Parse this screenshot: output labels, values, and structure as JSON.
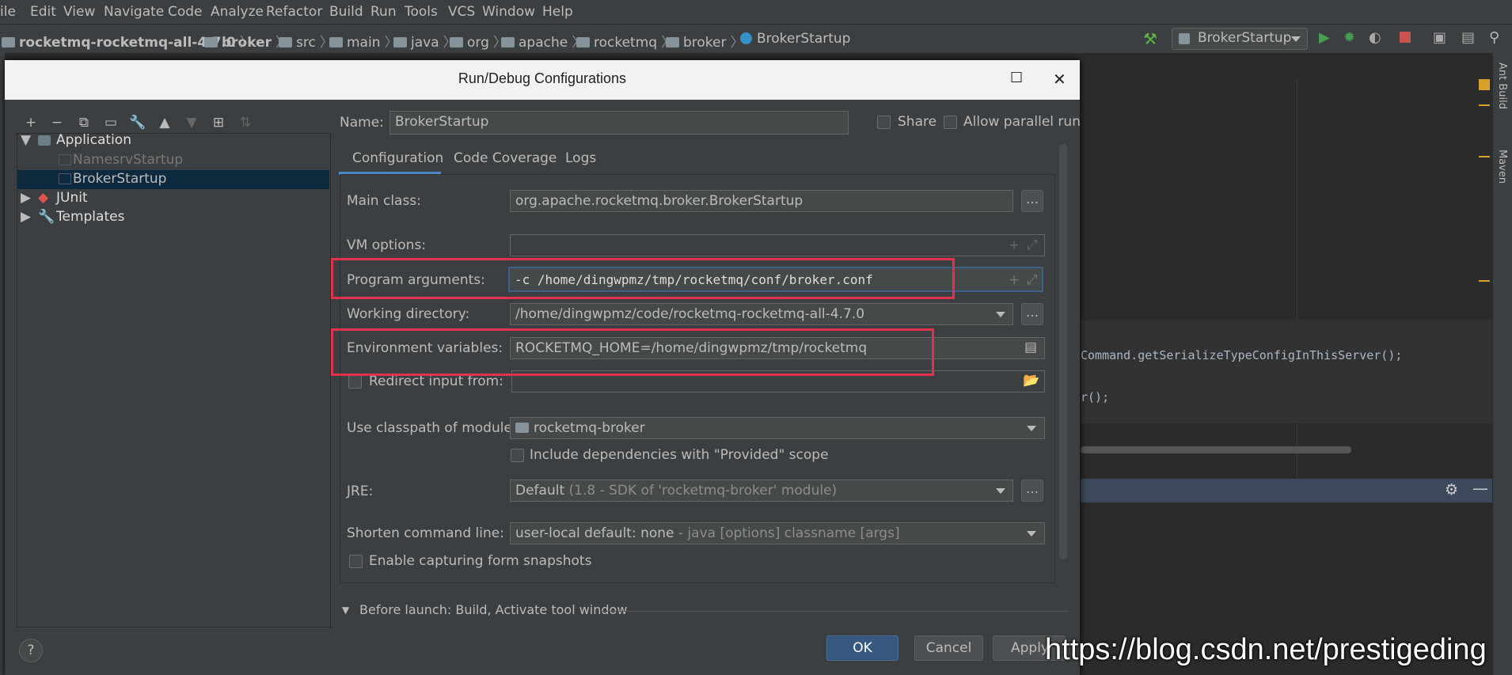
{
  "menu": [
    "ile",
    "Edit",
    "View",
    "Navigate",
    "Code",
    "Analyze",
    "Refactor",
    "Build",
    "Run",
    "Tools",
    "VCS",
    "Window",
    "Help"
  ],
  "breadcrumbs": [
    "rocketmq-rocketmq-all-4.7.0",
    "broker",
    "src",
    "main",
    "java",
    "org",
    "apache",
    "rocketmq",
    "broker",
    "BrokerStartup"
  ],
  "run_config_selector": "BrokerStartup",
  "right_tool_windows": [
    "Ant Build",
    "Maven"
  ],
  "editor_code": {
    "line1": "Command.getSerializeTypeConfigInThisServer();",
    "line2": "r();"
  },
  "dialog": {
    "title": "Run/Debug Configurations",
    "tree": {
      "application": "Application",
      "namesrv": "NamesrvStartup",
      "broker": "BrokerStartup",
      "junit": "JUnit",
      "templates": "Templates"
    },
    "name_label": "Name:",
    "name_value": "BrokerStartup",
    "share": "Share",
    "allow_parallel": "Allow parallel run",
    "tabs": [
      "Configuration",
      "Code Coverage",
      "Logs"
    ],
    "main_class_label": "Main class:",
    "main_class": "org.apache.rocketmq.broker.BrokerStartup",
    "vm_options_label": "VM options:",
    "vm_options": "",
    "program_args_label": "Program arguments:",
    "program_args": "-c /home/dingwpmz/tmp/rocketmq/conf/broker.conf",
    "working_dir_label": "Working directory:",
    "working_dir": "/home/dingwpmz/code/rocketmq-rocketmq-all-4.7.0",
    "env_label": "Environment variables:",
    "env_value": "ROCKETMQ_HOME=/home/dingwpmz/tmp/rocketmq",
    "redirect_label": "Redirect input from:",
    "classpath_label": "Use classpath of module:",
    "module": "rocketmq-broker",
    "include_provided": "Include dependencies with \"Provided\" scope",
    "jre_label": "JRE:",
    "jre_default": "Default",
    "jre_detail": "(1.8 - SDK of 'rocketmq-broker' module)",
    "shorten_label": "Shorten command line:",
    "shorten_value": "user-local default: none",
    "shorten_detail": " - java [options] classname [args]",
    "enable_snapshots": "Enable capturing form snapshots",
    "before_launch": "Before launch: Build, Activate tool window",
    "ok": "OK",
    "cancel": "Cancel",
    "apply": "Apply",
    "help": "?"
  },
  "watermark": "https://blog.csdn.net/prestigeding",
  "colors": {
    "accent": "#4a88c7",
    "highlight": "#e0324a",
    "ok_button": "#365880"
  }
}
